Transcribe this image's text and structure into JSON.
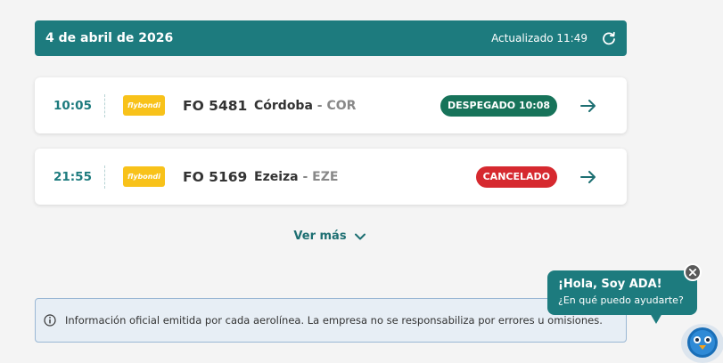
{
  "header": {
    "date": "4 de abril de 2026",
    "updated": "Actualizado 11:49",
    "refresh_icon": "refresh-icon"
  },
  "flights": [
    {
      "time": "10:05",
      "airline_logo_text": "flybondi",
      "code": "FO 5481",
      "destination": "Córdoba",
      "iata": " - COR",
      "status": "DESPEGADO 10:08",
      "status_color": "#17735a"
    },
    {
      "time": "21:55",
      "airline_logo_text": "flybondi",
      "code": "FO 5169",
      "destination": "Ezeiza",
      "iata": " - EZE",
      "status": "CANCELADO",
      "status_color": "#d6292f"
    }
  ],
  "more": {
    "label": "Ver más"
  },
  "info": {
    "text": "Información oficial emitida por cada aerolínea. La empresa no se responsabiliza por errores u omisiones."
  },
  "chat": {
    "title": "¡Hola, Soy ADA!",
    "subtitle": "¿En qué puedo ayudarte?"
  },
  "colors": {
    "accent": "#1d7b7e",
    "background": "#f4f4f4",
    "airline": "#f8c21a"
  }
}
